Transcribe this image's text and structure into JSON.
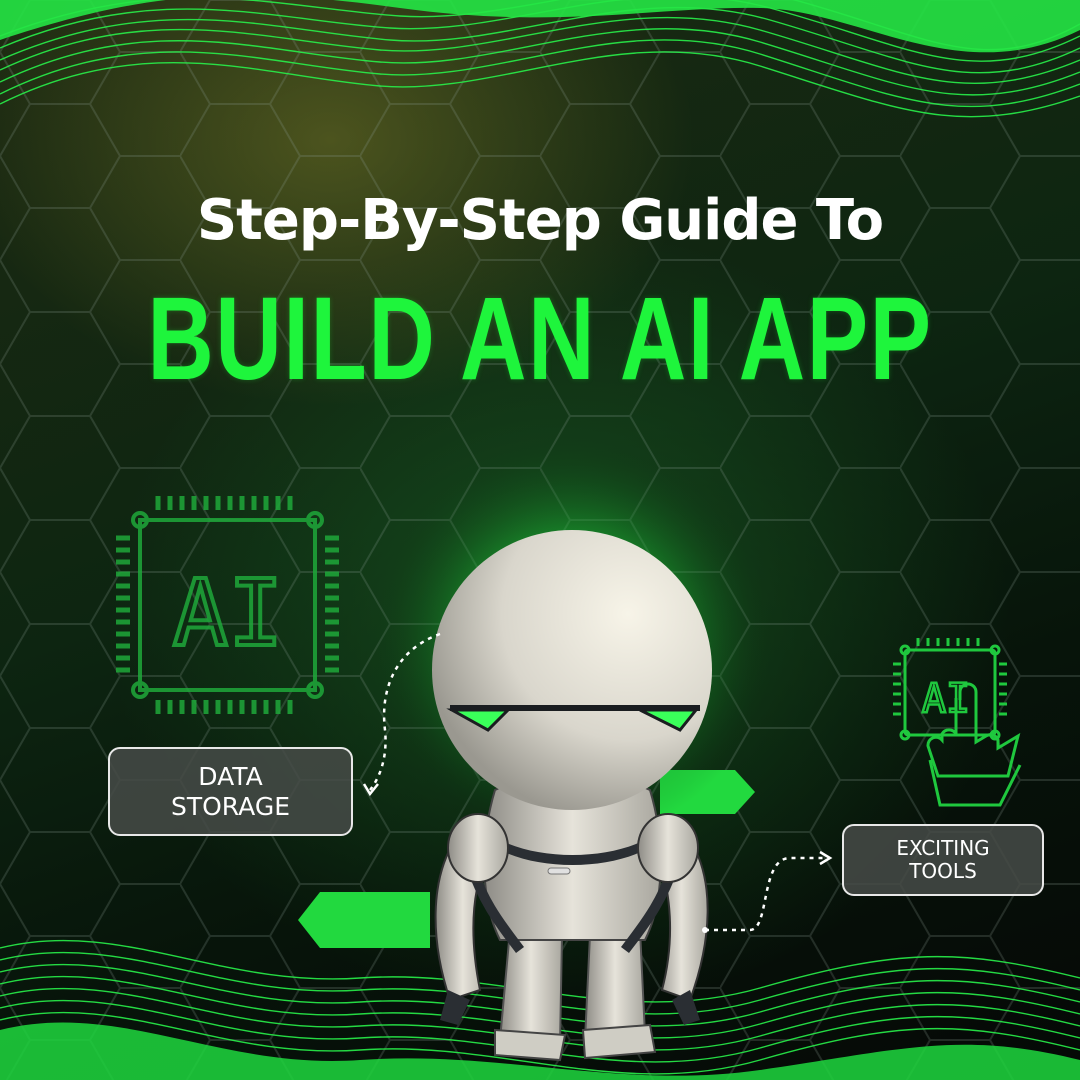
{
  "title": {
    "line1": "Step-By-Step Guide To",
    "line2": "BUILD AN AI APP"
  },
  "labels": {
    "data_storage": [
      "DATA",
      "STORAGE"
    ],
    "exciting_tools": [
      "EXCITING",
      "TOOLS"
    ]
  },
  "chip_text": "AI",
  "colors": {
    "accent_green": "#1ef53c",
    "background": "#07140a",
    "label_border": "#e8e8e8"
  }
}
